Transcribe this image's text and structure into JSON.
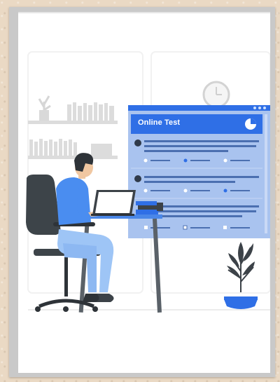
{
  "illustration": {
    "subject": "person-at-laptop-taking-online-test",
    "panel": {
      "title": "Online Test",
      "questions": [
        {
          "number": "1",
          "selected_option": 2
        },
        {
          "number": "2",
          "selected_option": 3
        }
      ]
    },
    "colors": {
      "accent": "#2f6fe6",
      "panel_bg": "#a9c3ef",
      "panel_header": "#2f6fe6",
      "shirt": "#4a8df0",
      "pants": "#9ec5f6",
      "chair": "#3d4449",
      "desk": "#4a87e8",
      "plant": "#3c4248",
      "pot": "#2f6fe6",
      "background_line": "#d9d9d9"
    }
  }
}
